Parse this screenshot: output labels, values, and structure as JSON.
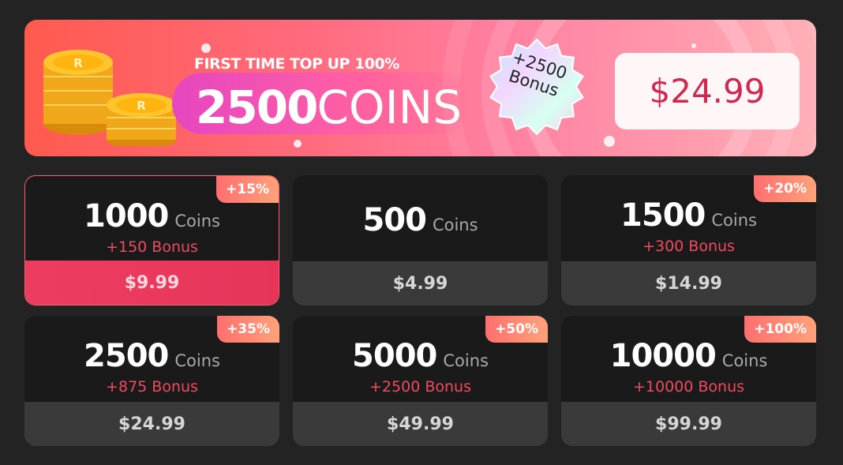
{
  "promo": {
    "label": "FIRST TIME TOP UP 100%",
    "amount_number": "2500",
    "amount_word": "COINS",
    "bonus_line1": "+2500",
    "bonus_line2": "Bonus",
    "price": "$24.99",
    "coin_icon": "coin-stack-icon",
    "coin_letter": "R"
  },
  "packages": [
    {
      "amount": "1000",
      "unit": "Coins",
      "bonus": "+150 Bonus",
      "price": "$9.99",
      "tag": "+15%",
      "selected": true
    },
    {
      "amount": "500",
      "unit": "Coins",
      "bonus": "",
      "price": "$4.99",
      "tag": "",
      "selected": false
    },
    {
      "amount": "1500",
      "unit": "Coins",
      "bonus": "+300 Bonus",
      "price": "$14.99",
      "tag": "+20%",
      "selected": false
    },
    {
      "amount": "2500",
      "unit": "Coins",
      "bonus": "+875 Bonus",
      "price": "$24.99",
      "tag": "+35%",
      "selected": false
    },
    {
      "amount": "5000",
      "unit": "Coins",
      "bonus": "+2500 Bonus",
      "price": "$49.99",
      "tag": "+50%",
      "selected": false
    },
    {
      "amount": "10000",
      "unit": "Coins",
      "bonus": "+10000 Bonus",
      "price": "$99.99",
      "tag": "+100%",
      "selected": false
    }
  ],
  "colors": {
    "background": "#232323",
    "card": "#1a1a1a",
    "price_bar": "#3a3a3a",
    "accent": "#ec3d60",
    "bonus_text": "#f04a60"
  }
}
